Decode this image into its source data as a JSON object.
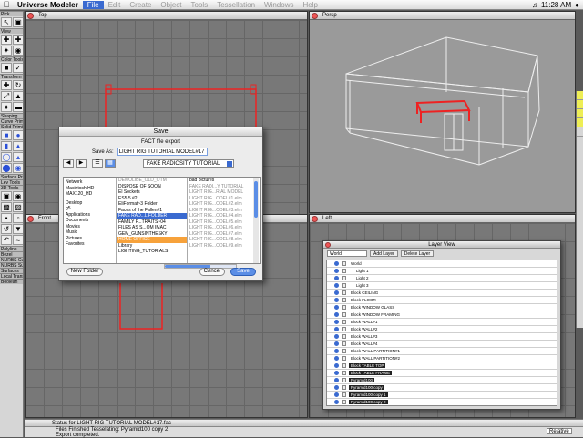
{
  "menubar": {
    "app": "Universe Modeler",
    "items": [
      "File",
      "Edit",
      "Create",
      "Object",
      "Tools",
      "Tessellation",
      "Windows",
      "Help"
    ],
    "clock": "11:28 AM"
  },
  "toolbox": {
    "sections": [
      "Pick",
      "View",
      "Color Tools",
      "Transform",
      "Shaping",
      "Curve Primitives",
      "Solid Primitives",
      "Surface Primiti...",
      "Lev Tools",
      "3D Tools",
      "Polyline",
      "Bezel",
      "NURBS Curve",
      "NURBS Surface",
      "Surfaces",
      "Local Transform",
      "Boolean"
    ]
  },
  "viewports": {
    "top": "Top",
    "persp": "Persp",
    "front": "Front",
    "left": "Left"
  },
  "status": {
    "title": "Status for LIGHT RIG TUTORIAL MODEL#17.fac",
    "line1": "Files Finished Tesselating: Pyramid100 copy 2",
    "line2": "Export completed.",
    "select_label": "Relative"
  },
  "dialog": {
    "title": "Save",
    "subtitle": "FACT file export",
    "save_as_label": "Save As:",
    "save_as_value": "LIGHT RIG TUTORIAL MODEL#17.fac",
    "folder": "FAKE RADIOSITY TUTORIAL",
    "col1": [
      "Network",
      "Macintosh HD",
      "MAX120_HD",
      "Desktop",
      "g5",
      "Applications",
      "Documents",
      "Movies",
      "Music",
      "Pictures",
      "Favorites"
    ],
    "col2": [
      "DEMOLIBE_OLD_OTM",
      "DISPOSE OF SOON",
      "El Sockets",
      "ES5.5 #2",
      "EliFormat~3 Folder",
      "Faces of the Fallen#1",
      "FAKE RAD...L FOLDER",
      "FAMILY P...TRAITS~04",
      "FILES AS S...OM IMAC",
      "GEM_GUNSINTHESKY",
      "HOME OFFICE",
      "Library",
      "LIGHTING_TUTORIALS"
    ],
    "col3": [
      "bad pictures",
      "FAKE RADI...Y TUTORIAL",
      "LIGHT RIG...RIAL MODEL",
      "LIGHT RIG...ODEL#1.elm",
      "LIGHT RIG...ODEL#2.elm",
      "LIGHT RIG...ODEL#3.elm",
      "LIGHT RIG...ODEL#4.elm",
      "LIGHT RIG...ODEL#5.elm",
      "LIGHT RIG...ODEL#6.elm",
      "LIGHT RIG...ODEL#7.elm",
      "LIGHT RIG...ODEL#8.elm",
      "LIGHT RIG...ODEL#9.elm"
    ],
    "new_folder": "New Folder",
    "cancel": "Cancel",
    "save": "Save"
  },
  "layer_view": {
    "title": "Layer View",
    "select": "World",
    "add_layer": "Add Layer",
    "delete_layer": "Delete Layer",
    "rows": [
      {
        "name": "World",
        "hi": false
      },
      {
        "name": "Light 1",
        "hi": false
      },
      {
        "name": "Light 2",
        "hi": false
      },
      {
        "name": "Light 3",
        "hi": false
      },
      {
        "name": "Block CEILING",
        "hi": false
      },
      {
        "name": "Block FLOOR",
        "hi": false
      },
      {
        "name": "Block WINDOW GLASS",
        "hi": false
      },
      {
        "name": "Block WINDOW FRAMING",
        "hi": false
      },
      {
        "name": "Block WALL#1",
        "hi": false
      },
      {
        "name": "Block WALL#2",
        "hi": false
      },
      {
        "name": "Block WALL#3",
        "hi": false
      },
      {
        "name": "Block WALL#4",
        "hi": false
      },
      {
        "name": "Block WALL PARTITION#1",
        "hi": false
      },
      {
        "name": "Block WALL PARTITION#2",
        "hi": false
      },
      {
        "name": "Block TABLE TOP",
        "hi": true
      },
      {
        "name": "Block TABLE FRAME",
        "hi": true
      },
      {
        "name": "Pyramid100",
        "hi": true
      },
      {
        "name": "Pyramid100 copy",
        "hi": true
      },
      {
        "name": "Pyramid100 copy 1",
        "hi": true
      },
      {
        "name": "Pyramid100 copy 2",
        "hi": true
      }
    ]
  }
}
